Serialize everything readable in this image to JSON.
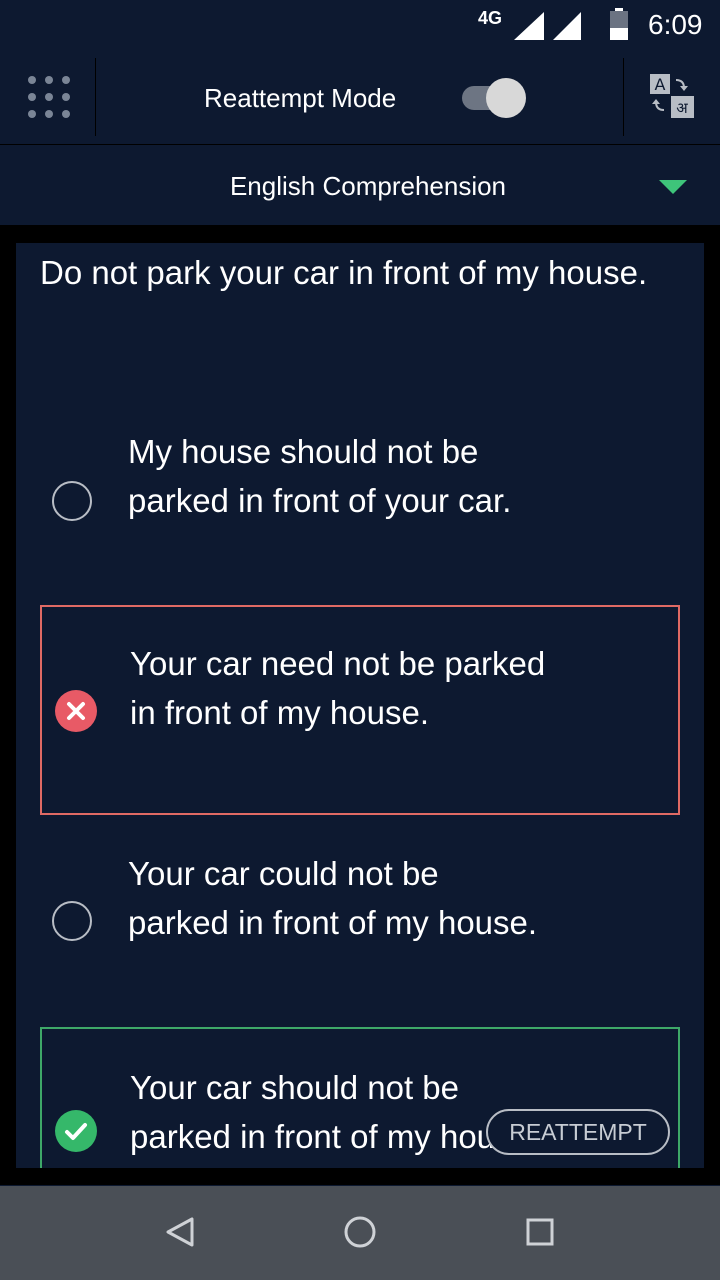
{
  "status_bar": {
    "network": "4G",
    "time": "6:09"
  },
  "header": {
    "menu_icon": "grid-menu-icon",
    "mode_label": "Reattempt Mode",
    "mode_enabled": true,
    "translate_icon": "translate-icon"
  },
  "subject": {
    "title": "English Comprehension",
    "caret_color": "#3ec47a"
  },
  "question": {
    "text": "Do not park your car in front of my house."
  },
  "options": [
    {
      "text": "My house should not be parked in front of your car.",
      "state": "unselected"
    },
    {
      "text": "Your car need not be parked in front of my house.",
      "state": "wrong"
    },
    {
      "text": "Your car could not be parked in front of my house.",
      "state": "unselected"
    },
    {
      "text": "Your car should not be parked in front of my house.",
      "state": "correct"
    }
  ],
  "reattempt_button": {
    "label": "REATTEMPT"
  },
  "colors": {
    "background": "#0d1930",
    "wrong": "#e06a64",
    "correct": "#3ea868"
  }
}
